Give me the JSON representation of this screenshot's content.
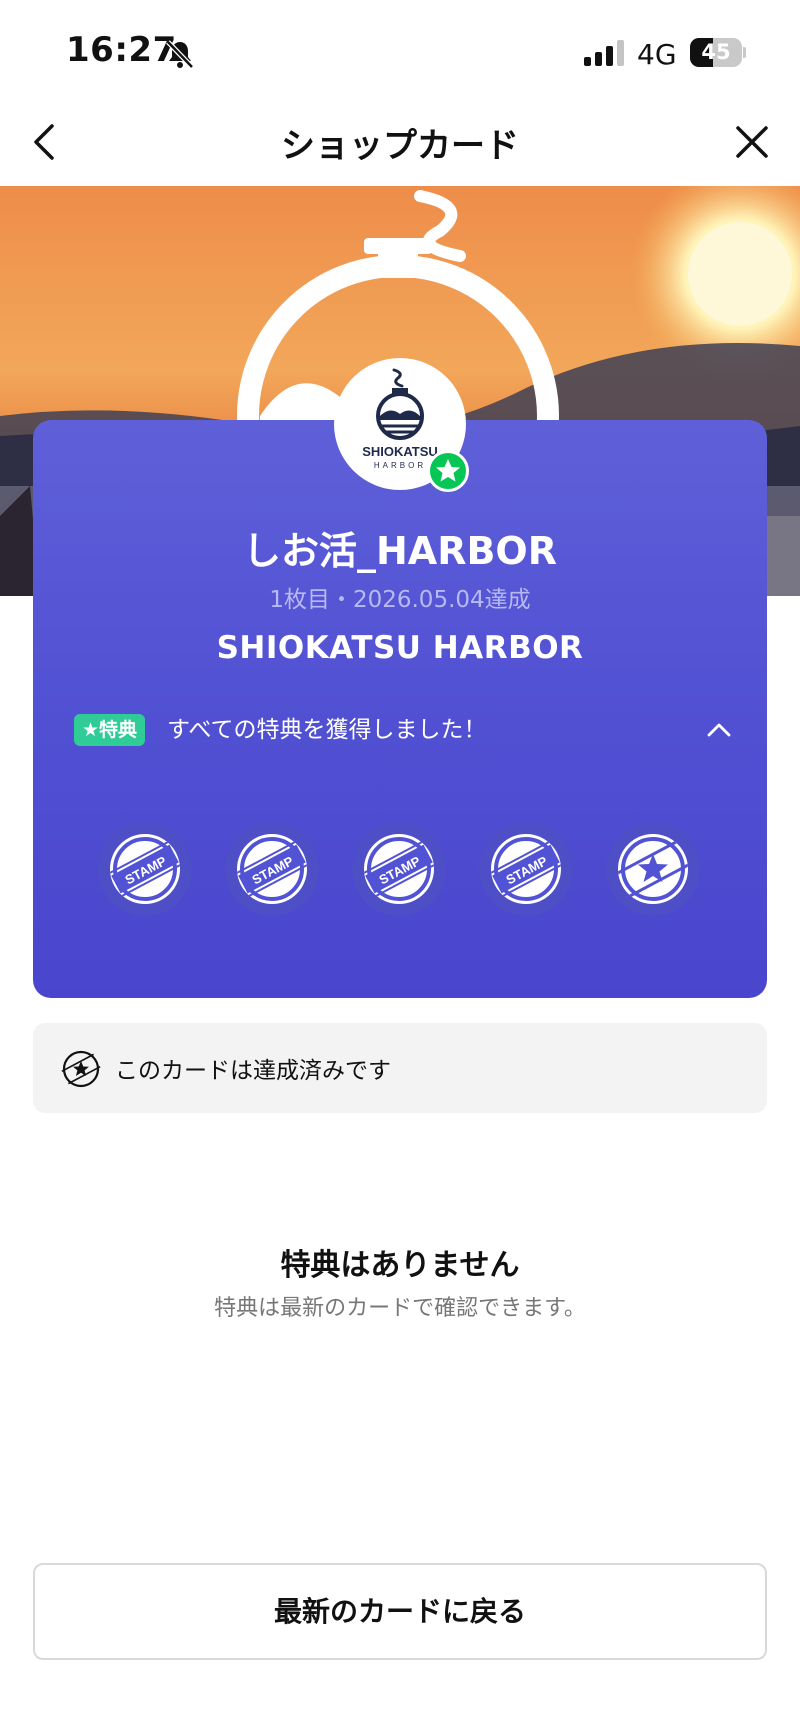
{
  "status_bar": {
    "time": "16:27",
    "network": "4G",
    "battery": "45",
    "battery_level": 0.45
  },
  "nav": {
    "title": "ショップカード"
  },
  "card": {
    "shop_name": "しお活_HARBOR",
    "meta": "1枚目・2026.05.04達成",
    "title": "SHIOKATSU HARBOR",
    "reward_tag": "★特典",
    "reward_text": "すべての特典を獲得しました！",
    "stamp_label": "STAMP",
    "logo_text": "SHIOKATSU",
    "logo_subtext": "HARBOR",
    "colors": {
      "card": "#5252d4",
      "badge": "#06c755",
      "tag": "#2fcc98"
    }
  },
  "notice": {
    "text": "このカードは達成済みです"
  },
  "empty": {
    "title": "特典はありません",
    "subtitle": "特典は最新のカードで確認できます。"
  },
  "button": {
    "label": "最新のカードに戻る"
  }
}
